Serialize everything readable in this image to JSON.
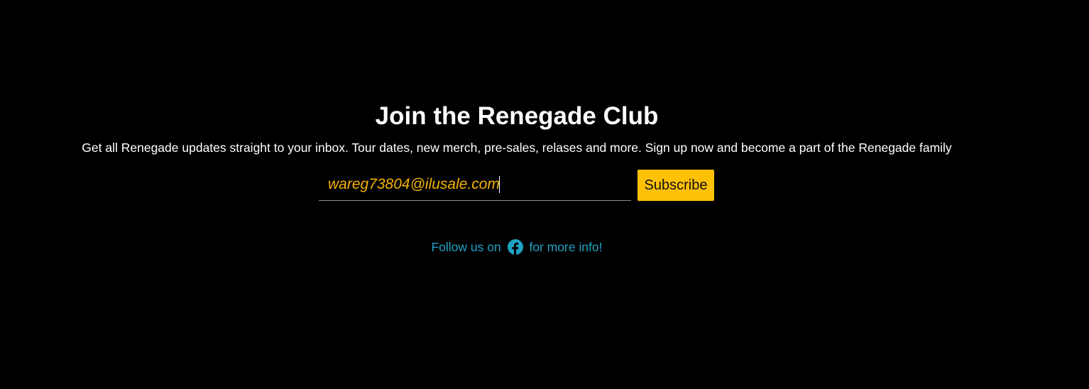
{
  "signup": {
    "title": "Join the Renegade Club",
    "description": "Get all Renegade updates straight to your inbox. Tour dates, new merch, pre-sales, relases and more. Sign up now and become a part of the Renegade family",
    "email_value": "wareg73804@ilusale.com",
    "subscribe_label": "Subscribe"
  },
  "follow": {
    "prefix": "Follow us on",
    "icon": "facebook-icon",
    "suffix": "for more info!"
  },
  "colors": {
    "background": "#000000",
    "accent": "#ffc107",
    "input_text": "#f5b20a",
    "link": "#1fa2c4"
  }
}
